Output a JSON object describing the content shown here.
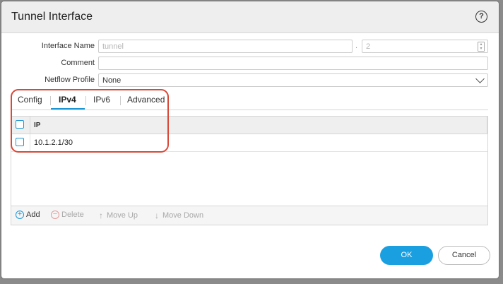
{
  "dialog": {
    "title": "Tunnel Interface",
    "help_glyph": "?"
  },
  "form": {
    "interface_name_label": "Interface Name",
    "interface_name_placeholder": "tunnel",
    "separator": ".",
    "subinterface_value": "2",
    "comment_label": "Comment",
    "comment_value": "",
    "netflow_label": "Netflow Profile",
    "netflow_value": "None"
  },
  "tabs": [
    {
      "label": "Config",
      "active": false
    },
    {
      "label": "IPv4",
      "active": true
    },
    {
      "label": "IPv6",
      "active": false
    },
    {
      "label": "Advanced",
      "active": false
    }
  ],
  "grid": {
    "column_header": "IP",
    "rows": [
      "10.1.2.1/30"
    ]
  },
  "toolbar": {
    "add_label": "Add",
    "delete_label": "Delete",
    "move_up_label": "Move Up",
    "move_down_label": "Move Down"
  },
  "buttons": {
    "ok_label": "OK",
    "cancel_label": "Cancel"
  },
  "colors": {
    "accent": "#1a96d4",
    "ok_button": "#1aa0e1",
    "highlight_annotation": "#d94838"
  }
}
